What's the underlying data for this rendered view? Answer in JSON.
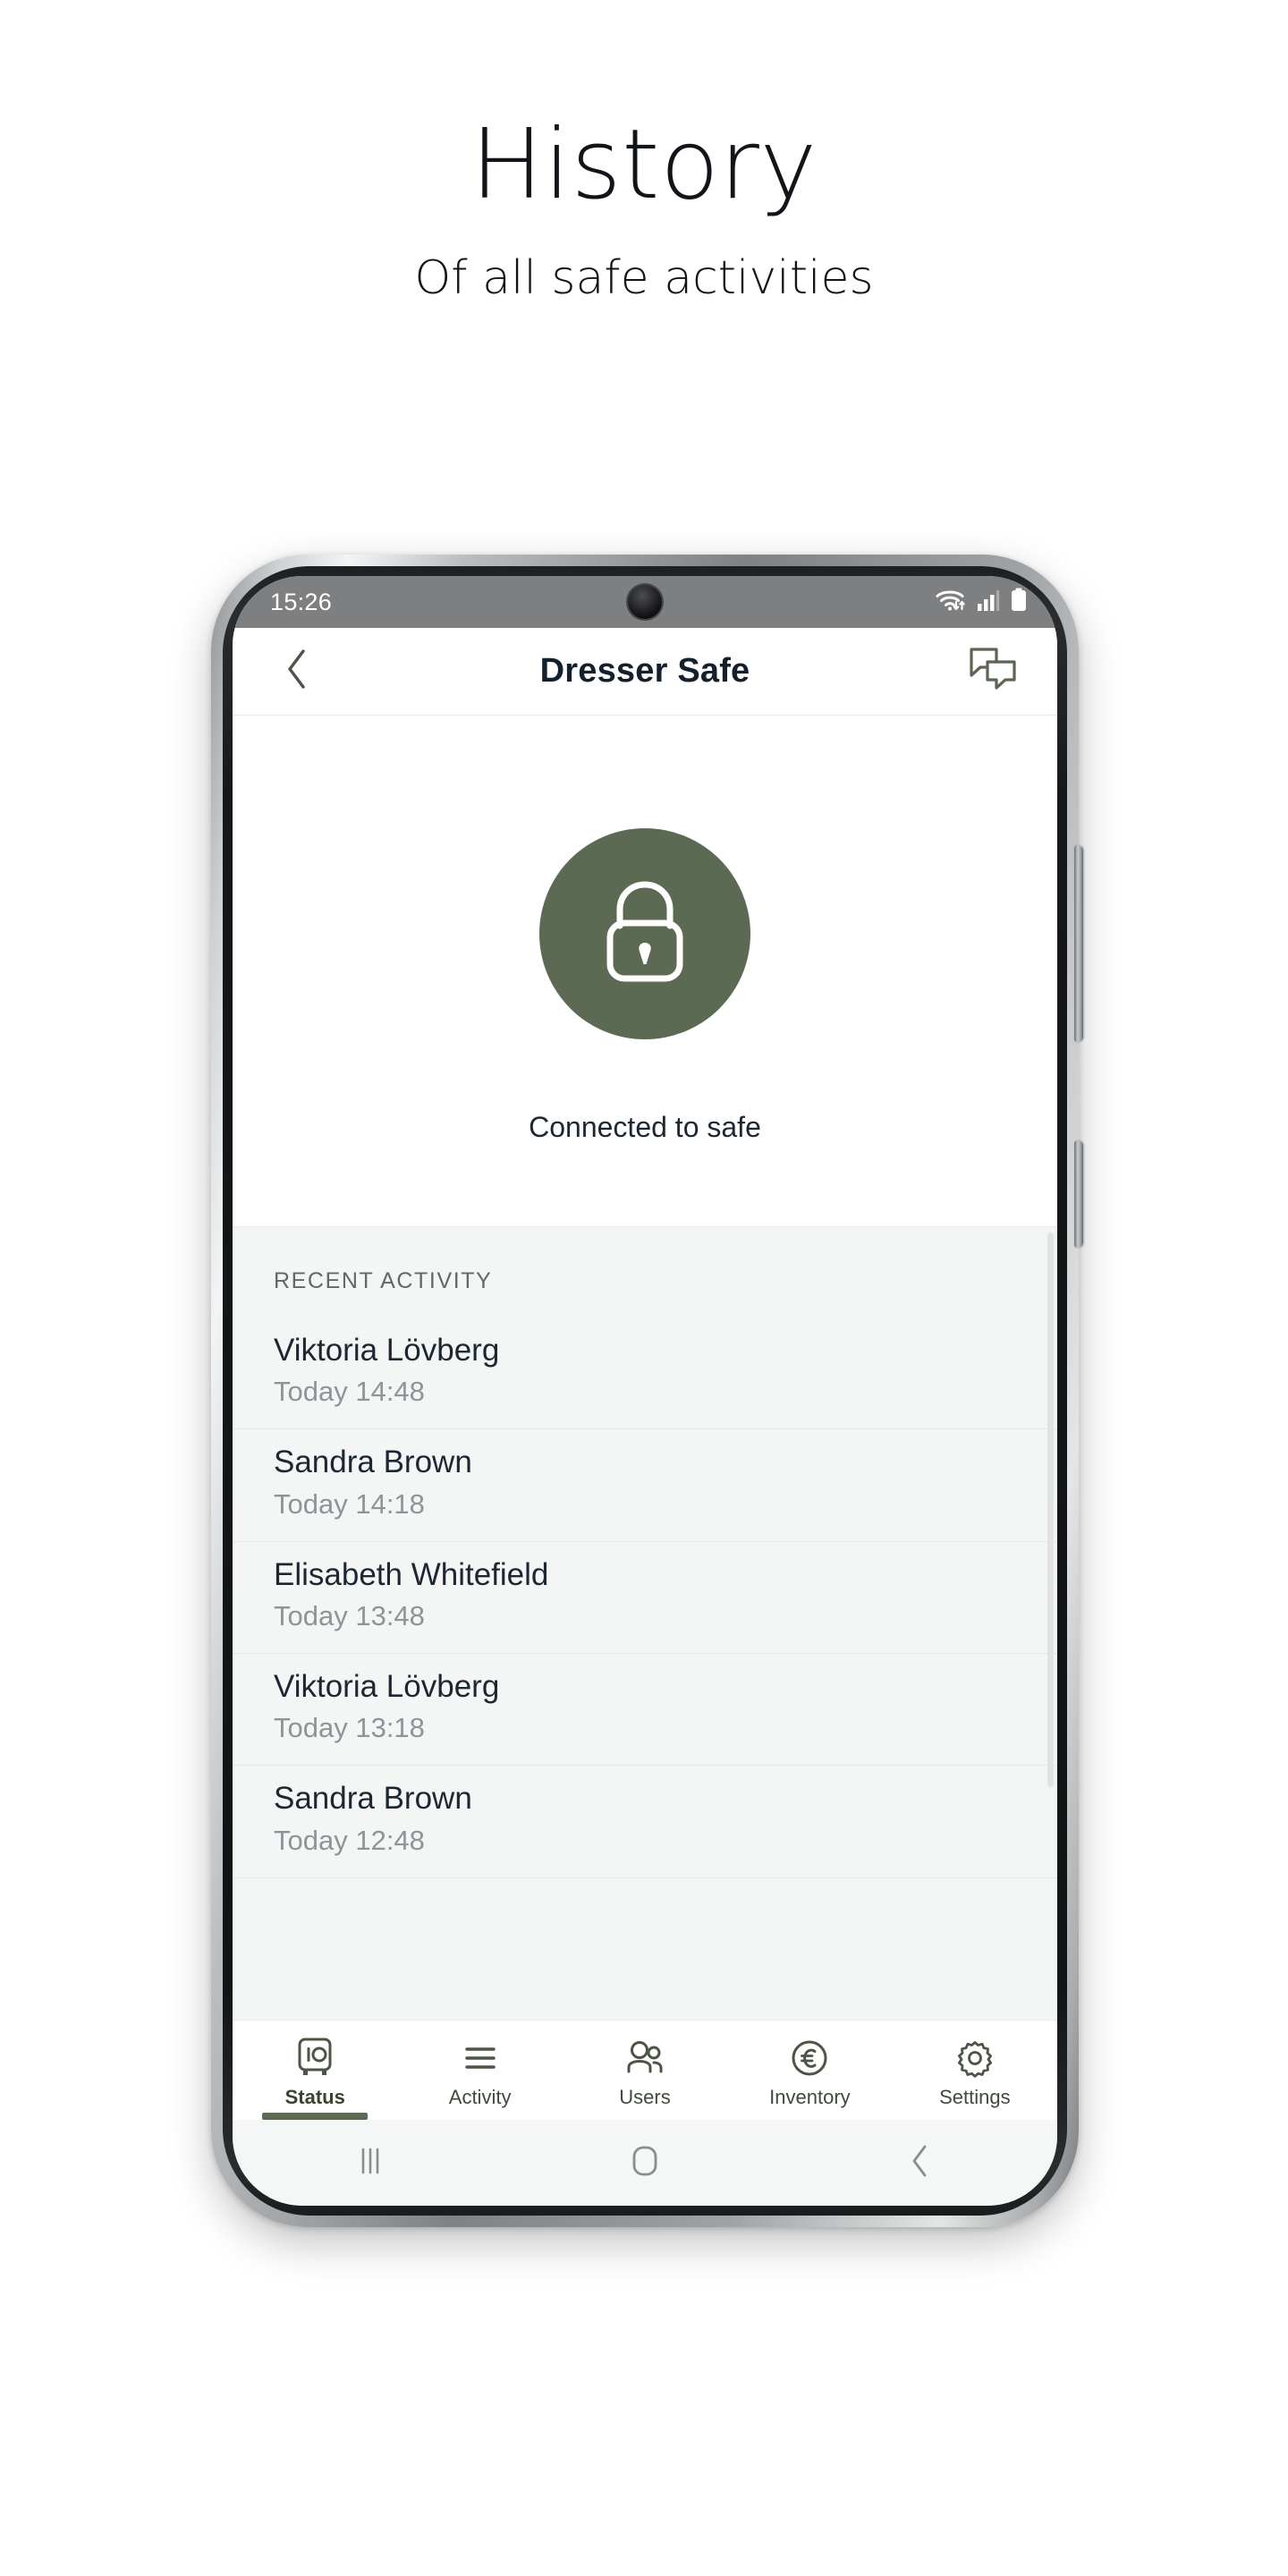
{
  "hero": {
    "title": "History",
    "subtitle": "Of all safe activities"
  },
  "phone": {
    "status_bar": {
      "time": "15:26",
      "icons": [
        "wifi-icon",
        "cellular-signal-icon",
        "battery-icon"
      ],
      "camera": "front-camera-punch-hole"
    },
    "app_header": {
      "back_icon": "chevron-left-icon",
      "title": "Dresser Safe",
      "chat_icon": "chat-bubbles-icon"
    },
    "safe_status": {
      "lock_icon": "padlock-closed-icon",
      "lock_circle_color": "#5d6a53",
      "connection_text": "Connected to safe"
    },
    "recent_activity": {
      "section_label": "RECENT ACTIVITY",
      "entries": [
        {
          "name": "Viktoria Lövberg",
          "time": "Today 14:48"
        },
        {
          "name": "Sandra Brown",
          "time": "Today 14:18"
        },
        {
          "name": "Elisabeth Whitefield",
          "time": "Today 13:48"
        },
        {
          "name": "Viktoria Lövberg",
          "time": "Today 13:18"
        },
        {
          "name": "Sandra Brown",
          "time": "Today 12:48"
        }
      ]
    },
    "tab_bar": {
      "active_index": 0,
      "active_color": "#5d6a53",
      "tabs": [
        {
          "label": "Status",
          "icon": "safe-vault-icon"
        },
        {
          "label": "Activity",
          "icon": "list-lines-icon"
        },
        {
          "label": "Users",
          "icon": "users-group-icon"
        },
        {
          "label": "Inventory",
          "icon": "euro-circle-icon"
        },
        {
          "label": "Settings",
          "icon": "gear-icon"
        }
      ]
    },
    "nav_bar": {
      "recents_icon": "recents-bars-icon",
      "home_icon": "home-square-icon",
      "back_icon": "back-chevron-icon"
    }
  }
}
